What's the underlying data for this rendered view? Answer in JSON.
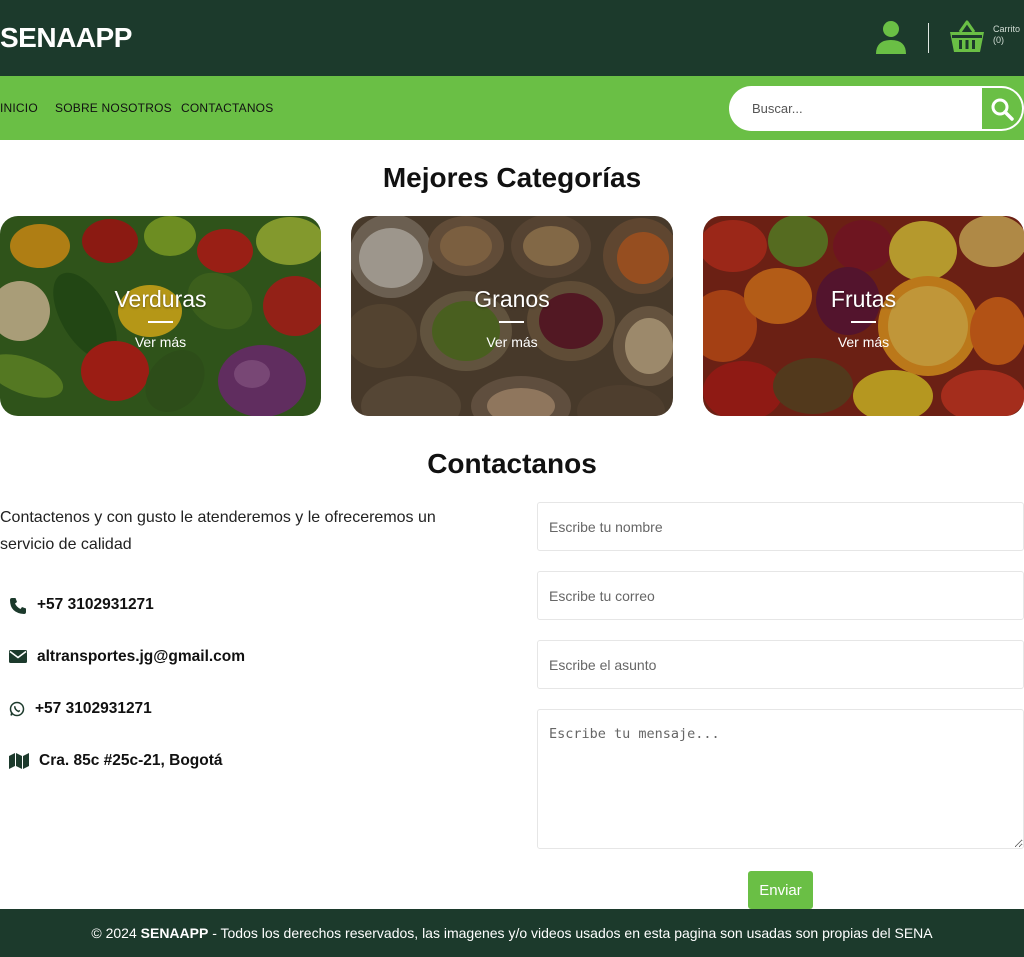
{
  "header": {
    "brand": "SENAAPP",
    "cart_label": "Carrito",
    "cart_count": "(0)"
  },
  "nav": {
    "items": [
      {
        "label": "INICIO"
      },
      {
        "label": "SOBRE NOSOTROS"
      },
      {
        "label": "CONTACTANOS"
      }
    ],
    "search_placeholder": "Buscar..."
  },
  "categories": {
    "title": "Mejores Categorías",
    "items": [
      {
        "name": "Verduras",
        "link": "Ver más"
      },
      {
        "name": "Granos",
        "link": "Ver más"
      },
      {
        "name": "Frutas",
        "link": "Ver más"
      }
    ]
  },
  "contact": {
    "title": "Contactanos",
    "description": "Contactenos y con gusto le atenderemos y le ofreceremos un servicio de calidad",
    "phone": "+57 3102931271",
    "email": "altransportes.jg@gmail.com",
    "whatsapp": "+57 3102931271",
    "address": "Cra. 85c #25c-21, Bogotá",
    "form": {
      "name_placeholder": "Escribe tu nombre",
      "email_placeholder": "Escribe tu correo",
      "subject_placeholder": "Escribe el asunto",
      "message_placeholder": "Escribe tu mensaje...",
      "submit_label": "Enviar"
    }
  },
  "footer": {
    "prefix": "© 2024 ",
    "brand": "SENAAPP",
    "text": " - Todos los derechos reservados, las imagenes y/o videos usados en esta pagina son usadas son propias del SENA"
  },
  "colors": {
    "header_bg": "#1c3a2c",
    "accent": "#6abf45"
  }
}
